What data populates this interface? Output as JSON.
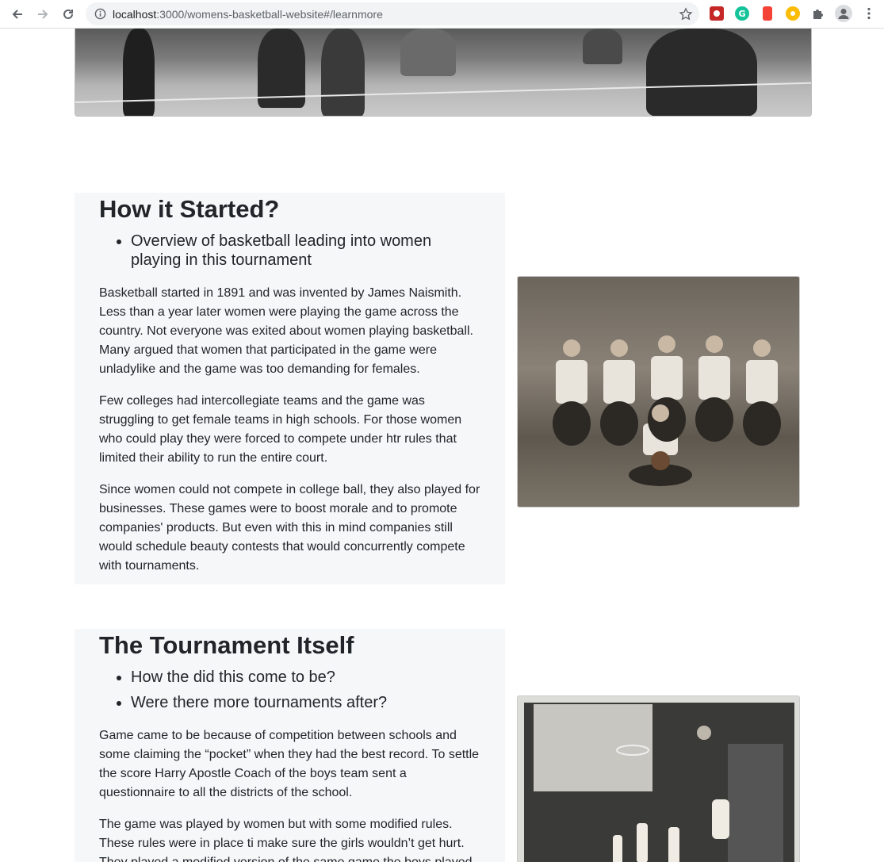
{
  "browser": {
    "url_host": "localhost",
    "url_rest": ":3000/womens-basketball-website#/learnmore"
  },
  "section1": {
    "title": "How it Started?",
    "bullets": [
      "Overview of basketball leading into women playing in this tournament"
    ],
    "paragraphs": [
      "Basketball started in 1891 and was invented by James Naismith. Less than a year later women were playing the game across the country. Not everyone was exited about women playing basketball. Many argued that women that participated in the game were unladylike and the game was too demanding for females.",
      "Few colleges had intercollegiate teams and the game was struggling to get female teams in high schools. For those women who could play they were forced to compete under htr rules that limited their ability to run the entire court.",
      "Since women could not compete in college ball, they also played for businesses. These games were to boost morale and to promote companies' products. But even with this in mind companies still would schedule beauty contests that would concurrently compete with tournaments."
    ]
  },
  "section2": {
    "title": "The Tournament Itself",
    "bullets": [
      "How the did this come to be?",
      "Were there more tournaments after?"
    ],
    "paragraphs": [
      "Game came to be because of competition between schools and some claiming the “pocket” when they had the best record. To settle the score Harry Apostle Coach of the boys team sent a questionnaire to all the districts of the school.",
      "The game was played by women but with some modified rules. These rules were in place ti make sure the girls wouldn’t get hurt. They played a modified version of the same game the boys played."
    ]
  }
}
